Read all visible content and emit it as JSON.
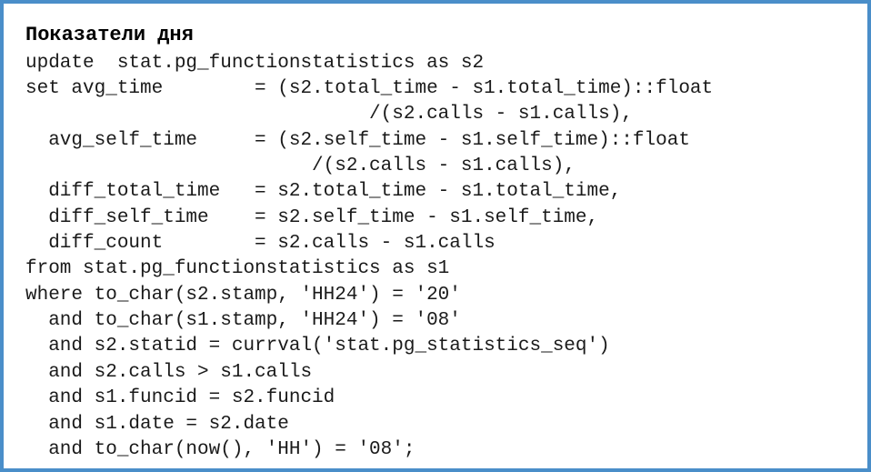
{
  "heading": "Показатели дня",
  "code_lines": [
    "update  stat.pg_functionstatistics as s2",
    "set avg_time        = (s2.total_time - s1.total_time)::float",
    "                              /(s2.calls - s1.calls),",
    "  avg_self_time     = (s2.self_time - s1.self_time)::float",
    "                         /(s2.calls - s1.calls),",
    "  diff_total_time   = s2.total_time - s1.total_time,",
    "  diff_self_time    = s2.self_time - s1.self_time,",
    "  diff_count        = s2.calls - s1.calls",
    "from stat.pg_functionstatistics as s1",
    "where to_char(s2.stamp, 'HH24') = '20'",
    "  and to_char(s1.stamp, 'HH24') = '08'",
    "  and s2.statid = currval('stat.pg_statistics_seq')",
    "  and s2.calls > s1.calls",
    "  and s1.funcid = s2.funcid",
    "  and s1.date = s2.date",
    "  and to_char(now(), 'HH') = '08';"
  ]
}
